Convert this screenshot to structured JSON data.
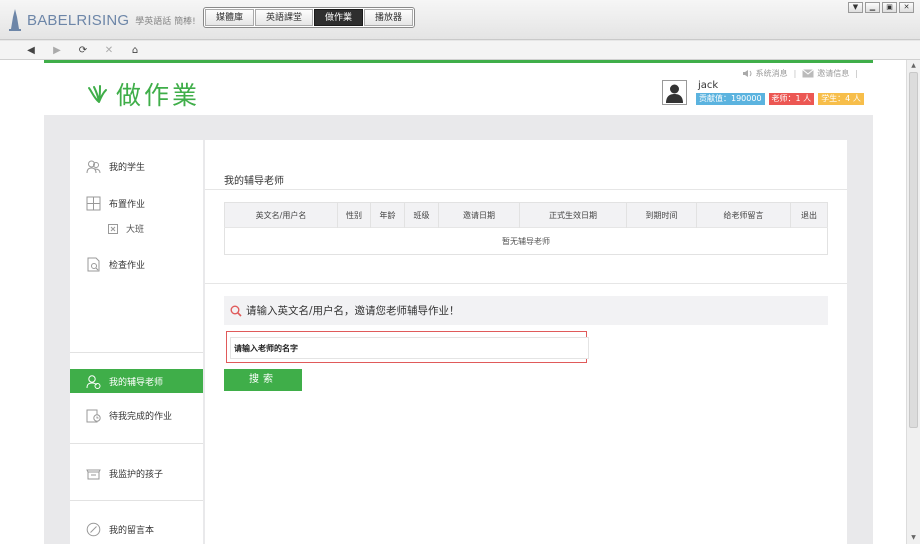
{
  "app": {
    "brand": "BABELRISING",
    "tagline": "學英語話  簡棒!",
    "tabs": [
      {
        "label": "媒體庫"
      },
      {
        "label": "英語課堂"
      },
      {
        "label": "做作業"
      },
      {
        "label": "播放器"
      }
    ],
    "active_tab": "做作業",
    "window_controls": [
      "menu",
      "minimize",
      "restore",
      "close"
    ]
  },
  "nav": {
    "buttons": [
      "back",
      "forward",
      "refresh",
      "stop",
      "home"
    ]
  },
  "header": {
    "title": "做作業",
    "links": [
      "系统消息",
      "邀请信息"
    ],
    "user": {
      "name": "jack",
      "badges": [
        {
          "text": "贡献值：190000",
          "color": "#5bb3df"
        },
        {
          "text": "老师：1 人",
          "color": "#ec5753"
        },
        {
          "text": "学生：4 人",
          "color": "#f7be4a"
        }
      ]
    }
  },
  "sidebar": {
    "items": [
      {
        "label": "我的学生",
        "icon": "students-icon"
      },
      {
        "label": "布置作业",
        "icon": "assign-homework-icon"
      },
      {
        "label": "大班",
        "icon": "class-icon"
      },
      {
        "label": "检查作业",
        "icon": "check-homework-icon"
      },
      {
        "label": "我的辅导老师",
        "icon": "tutor-icon"
      },
      {
        "label": "待我完成的作业",
        "icon": "pending-homework-icon"
      },
      {
        "label": "我监护的孩子",
        "icon": "children-icon"
      },
      {
        "label": "我的留言本",
        "icon": "guestbook-icon"
      }
    ],
    "active": "我的辅导老师"
  },
  "main": {
    "section_title": "我的辅导老师",
    "table": {
      "columns": [
        "英文名/用户名",
        "性别",
        "年龄",
        "班级",
        "邀请日期",
        "正式生效日期",
        "到期时间",
        "给老师留言",
        "退出"
      ],
      "empty_text": "暂无辅导老师"
    },
    "search": {
      "prompt": "请输入英文名/用户名，邀请您老师辅导作业！",
      "placeholder": "请输入老师的名字",
      "button": "搜索"
    }
  },
  "colors": {
    "accent": "#3fae49",
    "input_border": "#e05a5a"
  }
}
